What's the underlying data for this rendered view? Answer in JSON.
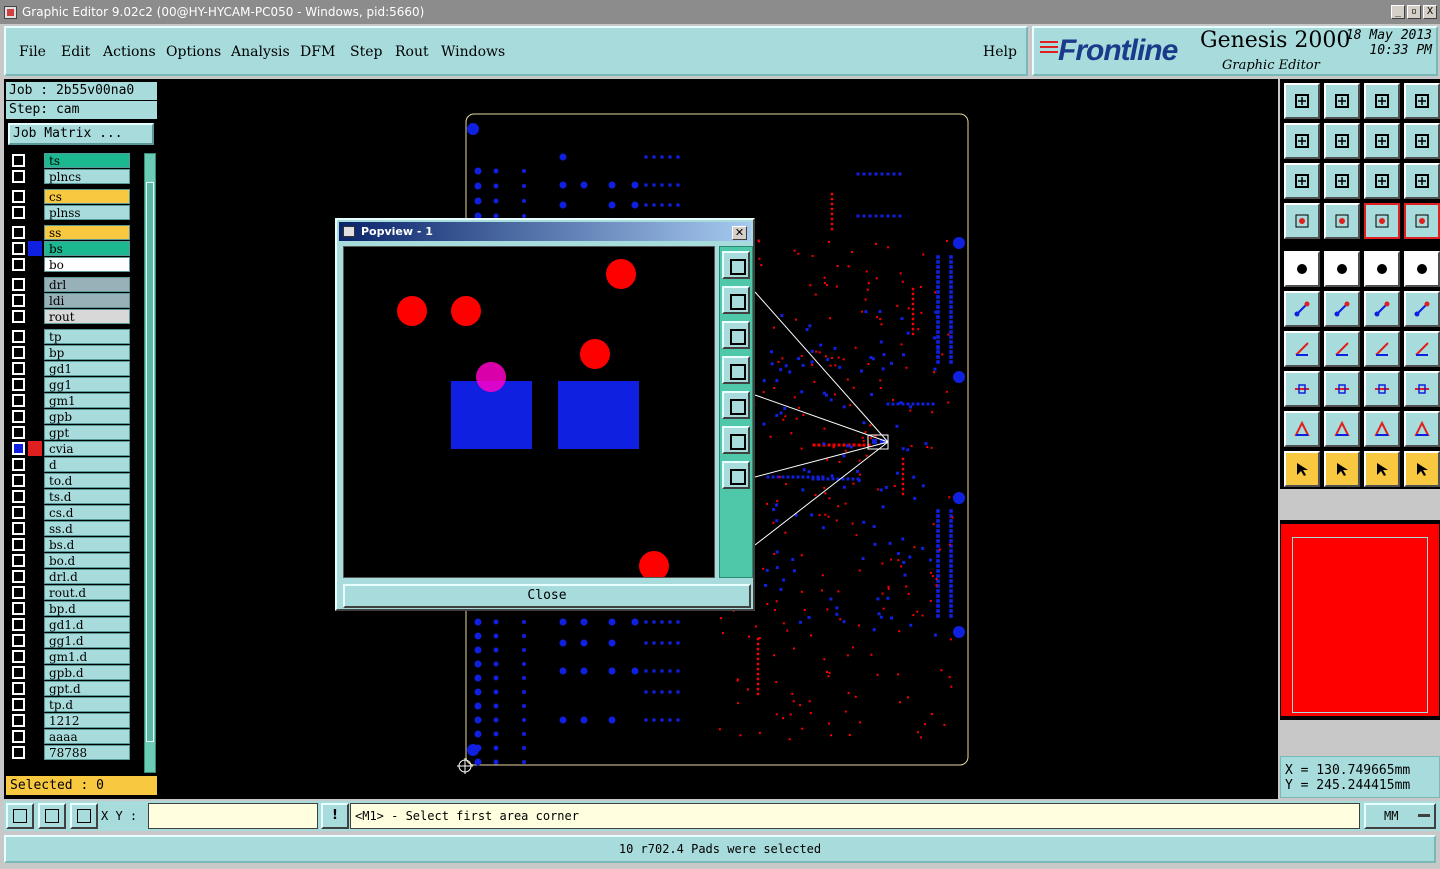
{
  "window": {
    "title": "Graphic Editor 9.02c2 (00@HY-HYCAM-PC050 - Windows, pid:5660)",
    "controls": [
      "_",
      "▫",
      "X"
    ]
  },
  "menu": {
    "items": [
      "File",
      "Edit",
      "Actions",
      "Options",
      "Analysis",
      "DFM",
      "Step",
      "Rout",
      "Windows"
    ],
    "help": "Help"
  },
  "brand": {
    "logo": "Frontline",
    "product": "Genesis 2000",
    "subtitle": "Graphic Editor",
    "date": "18 May 2013",
    "time": "10:33 PM"
  },
  "job": {
    "job_line": "Job : 2b55v00na0",
    "step_line": "Step: cam",
    "matrix_button": "Job Matrix ..."
  },
  "layers": [
    {
      "name": "ts",
      "color": "#1cb890",
      "swatch": "#000000"
    },
    {
      "name": "plncs",
      "color": "#a8dcdc",
      "swatch": "#000000"
    },
    {
      "name": "cs",
      "color": "#f8c840",
      "swatch": "#000000"
    },
    {
      "name": "plnss",
      "color": "#a8dcdc",
      "swatch": "#000000"
    },
    {
      "name": "ss",
      "color": "#f8c840",
      "swatch": "#000000"
    },
    {
      "name": "bs",
      "color": "#1cb890",
      "swatch": "#1020e0"
    },
    {
      "name": "bo",
      "color": "#ffffff",
      "swatch": "#000000"
    },
    {
      "name": "drl",
      "color": "#98b0b8",
      "swatch": "#000000"
    },
    {
      "name": "ldi",
      "color": "#98b0b8",
      "swatch": "#000000"
    },
    {
      "name": "rout",
      "color": "#d8d8d8",
      "swatch": "#000000"
    },
    {
      "name": "tp",
      "color": "#a8dcdc",
      "swatch": "#000000"
    },
    {
      "name": "bp",
      "color": "#a8dcdc",
      "swatch": "#000000"
    },
    {
      "name": "gd1",
      "color": "#a8dcdc",
      "swatch": "#000000"
    },
    {
      "name": "gg1",
      "color": "#a8dcdc",
      "swatch": "#000000"
    },
    {
      "name": "gm1",
      "color": "#a8dcdc",
      "swatch": "#000000"
    },
    {
      "name": "gpb",
      "color": "#a8dcdc",
      "swatch": "#000000"
    },
    {
      "name": "gpt",
      "color": "#a8dcdc",
      "swatch": "#000000"
    },
    {
      "name": "cvia",
      "color": "#a8dcdc",
      "swatch": "#e02020",
      "active": true
    },
    {
      "name": "d",
      "color": "#a8dcdc",
      "swatch": "#000000"
    },
    {
      "name": "to.d",
      "color": "#a8dcdc",
      "swatch": "#000000"
    },
    {
      "name": "ts.d",
      "color": "#a8dcdc",
      "swatch": "#000000"
    },
    {
      "name": "cs.d",
      "color": "#a8dcdc",
      "swatch": "#000000"
    },
    {
      "name": "ss.d",
      "color": "#a8dcdc",
      "swatch": "#000000"
    },
    {
      "name": "bs.d",
      "color": "#a8dcdc",
      "swatch": "#000000"
    },
    {
      "name": "bo.d",
      "color": "#a8dcdc",
      "swatch": "#000000"
    },
    {
      "name": "drl.d",
      "color": "#a8dcdc",
      "swatch": "#000000"
    },
    {
      "name": "rout.d",
      "color": "#a8dcdc",
      "swatch": "#000000"
    },
    {
      "name": "bp.d",
      "color": "#a8dcdc",
      "swatch": "#000000"
    },
    {
      "name": "gd1.d",
      "color": "#a8dcdc",
      "swatch": "#000000"
    },
    {
      "name": "gg1.d",
      "color": "#a8dcdc",
      "swatch": "#000000"
    },
    {
      "name": "gm1.d",
      "color": "#a8dcdc",
      "swatch": "#000000"
    },
    {
      "name": "gpb.d",
      "color": "#a8dcdc",
      "swatch": "#000000"
    },
    {
      "name": "gpt.d",
      "color": "#a8dcdc",
      "swatch": "#000000"
    },
    {
      "name": "tp.d",
      "color": "#a8dcdc",
      "swatch": "#000000"
    },
    {
      "name": "1212",
      "color": "#a8dcdc",
      "swatch": "#000000"
    },
    {
      "name": "aaaa",
      "color": "#a8dcdc",
      "swatch": "#000000"
    },
    {
      "name": "78788",
      "color": "#a8dcdc",
      "swatch": "#000000"
    }
  ],
  "selected_label": "Selected : 0",
  "popview": {
    "title": "Popview - 1",
    "close_label": "Close"
  },
  "coords": {
    "x_line": "X = 130.749665mm",
    "y_line": "Y = 245.244415mm"
  },
  "command": {
    "xy_label": "X Y :",
    "xy_value": "",
    "prompt": "<M1> - Select first area corner",
    "units": "MM"
  },
  "status": "10 r702.4 Pads were selected",
  "colors": {
    "panel": "#a8dcdc",
    "pad_red": "#ff0000",
    "pad_blue": "#1020e0",
    "board_outline": "#e8d8a0"
  },
  "toolbar_icons": [
    "open-icon",
    "save-icon",
    "home-icon",
    "window-icon",
    "pan-left-icon",
    "pan-right-icon",
    "undo-icon",
    "snap-icon",
    "zoom-fit-icon",
    "zoom-all-icon",
    "scale-icon",
    "help-icon",
    "settings-icon",
    "grid-icon",
    "layer-red-icon",
    "layer-red2-icon",
    "pad-icon",
    "color-icon",
    "ruler-icon",
    "circle-icon",
    "connect-icon",
    "cross-icon",
    "line-icon",
    "line2-icon",
    "angle-icon",
    "slope-icon",
    "arc-icon",
    "flip-icon",
    "pads-icon",
    "measure-icon",
    "width-icon",
    "shapes-icon",
    "tri-icon",
    "tri2-icon",
    "tri3-icon",
    "tri4-icon",
    "select-icon",
    "select2-icon",
    "select3-icon",
    "select4-icon"
  ]
}
